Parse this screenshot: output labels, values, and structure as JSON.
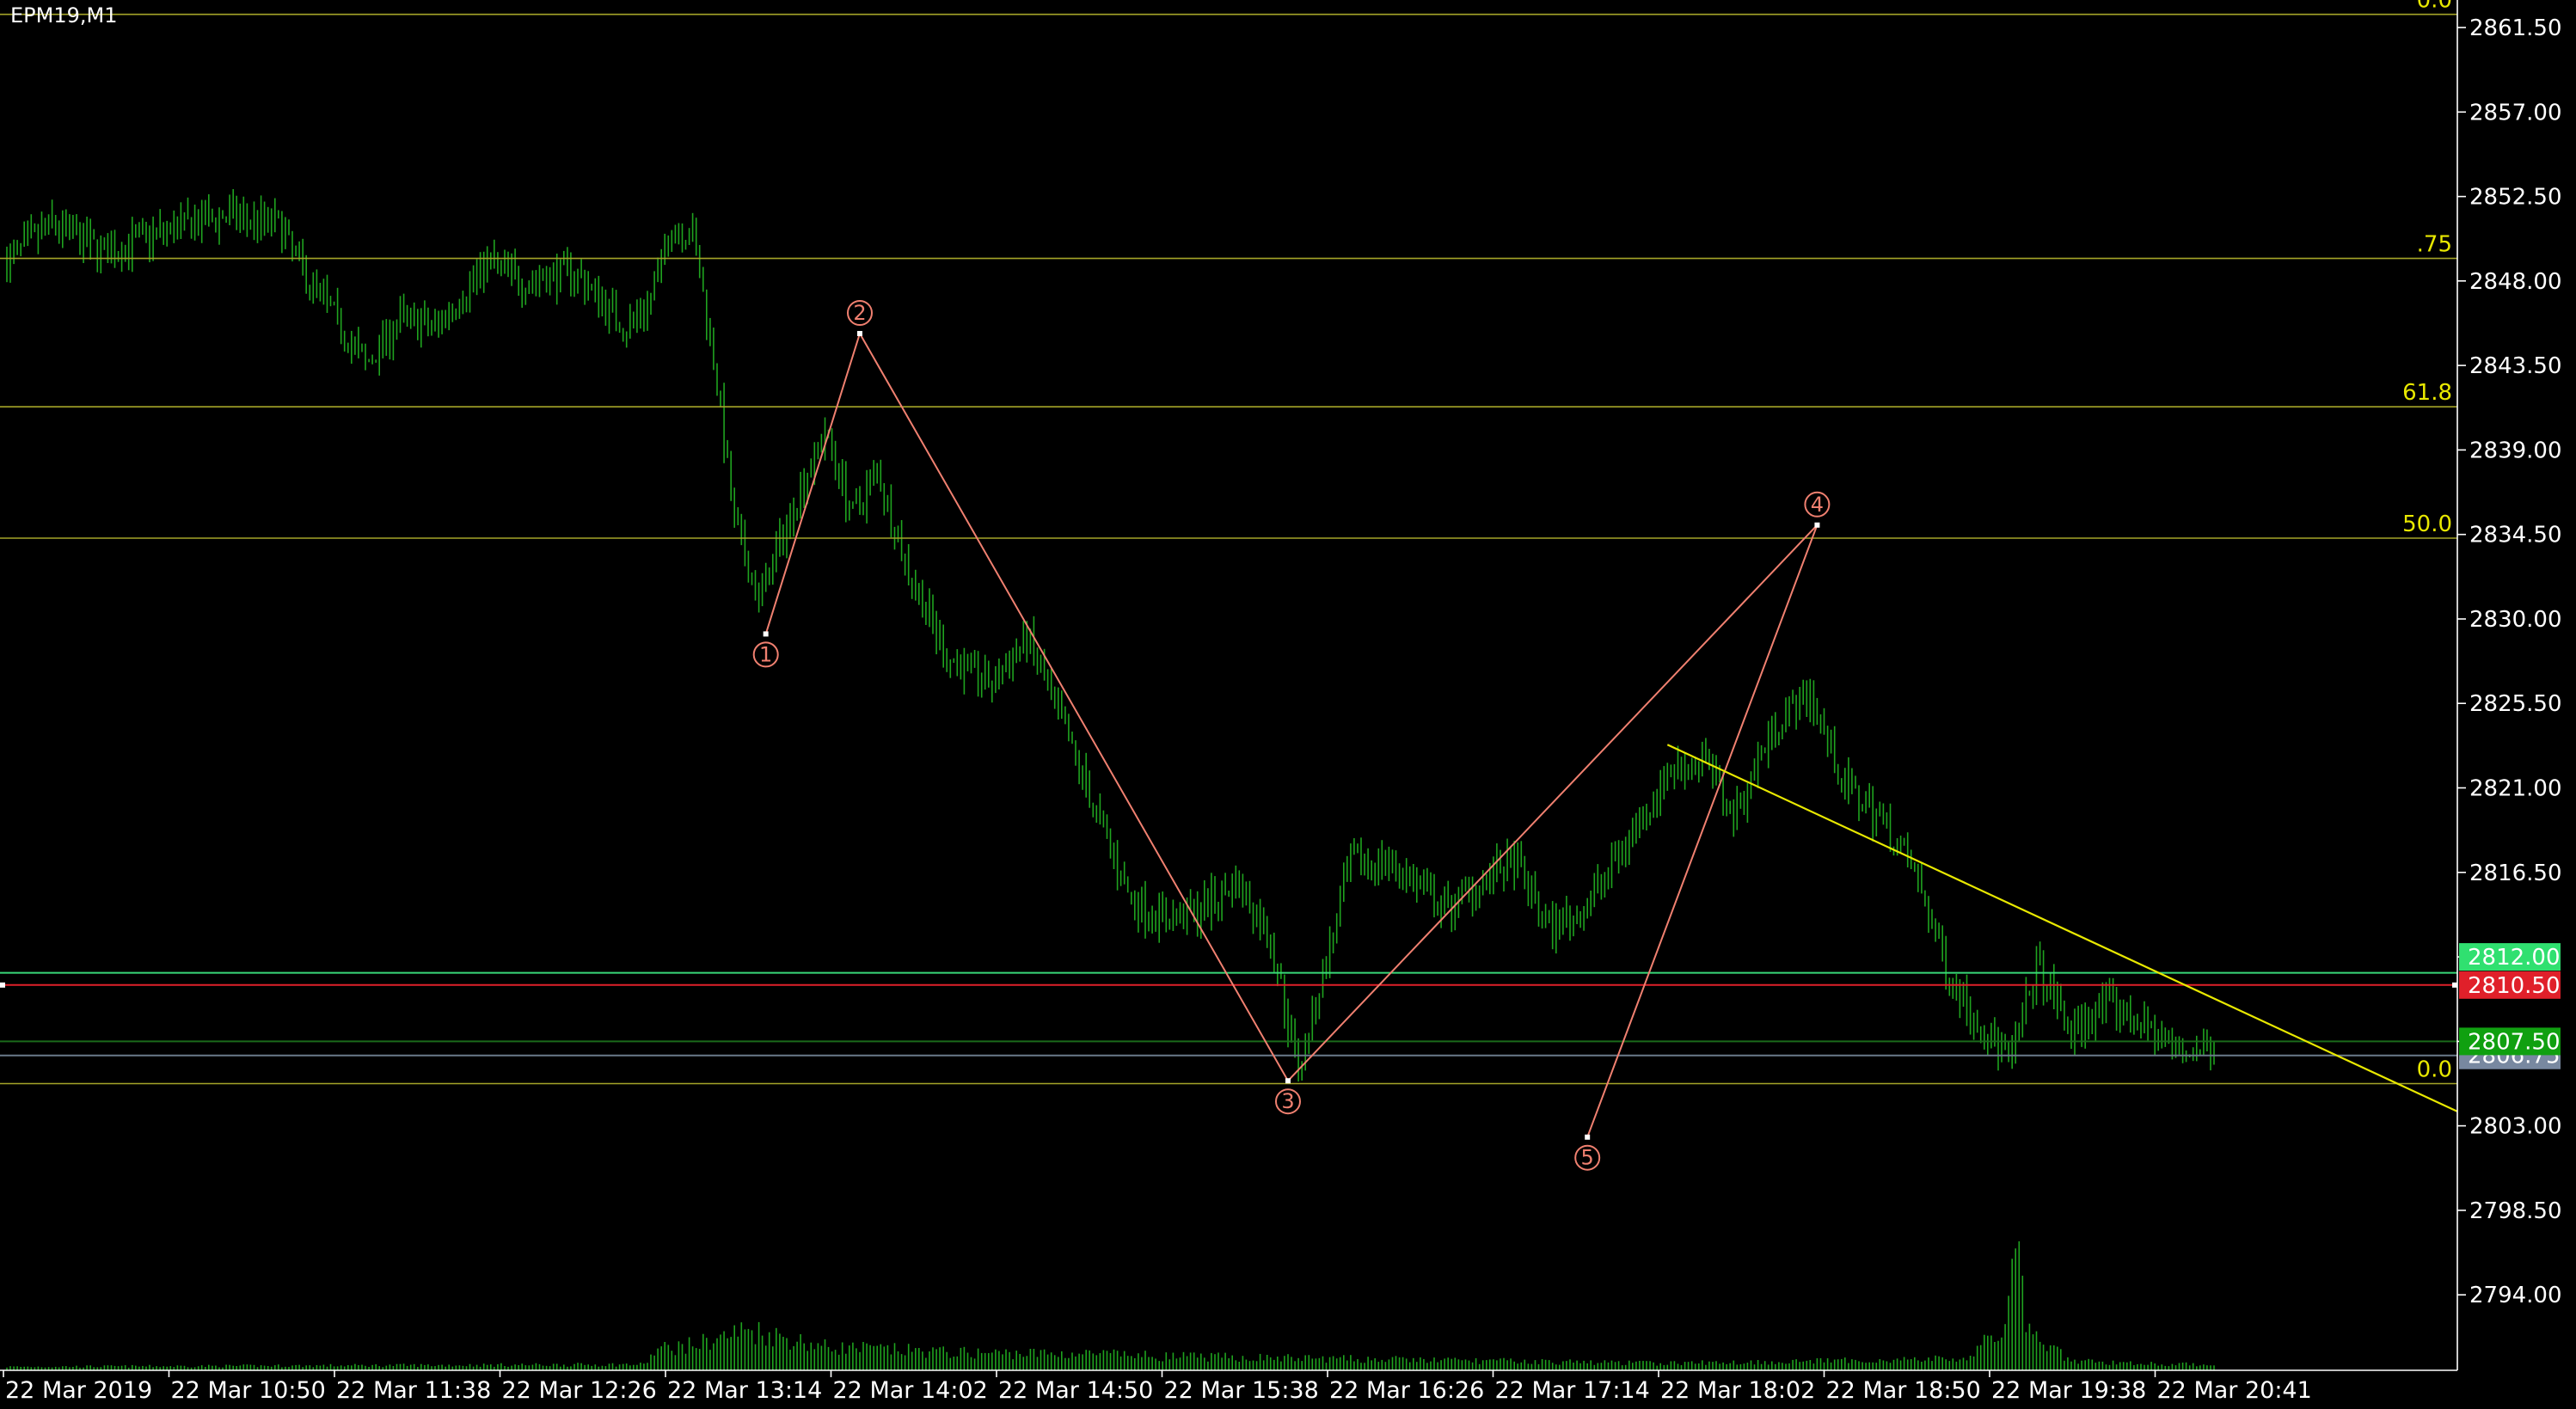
{
  "symbol": "EPM19,M1",
  "colors": {
    "background": "#000000",
    "grid_axis": "#ffffff",
    "candles": "#1fa31f",
    "volume": "#1fa31f",
    "fib_lines": "#a5a528",
    "fib_labels": "#e8e800",
    "wave_lines": "#f08070",
    "trendline": "#e8e800",
    "line_green": "#38d878",
    "line_red": "#e0202a",
    "line_darkgreen": "#1a6a1a",
    "line_gray": "#6a7a8a",
    "tag_bid": "#7888a0",
    "tag_green": "#10a010",
    "tag_red": "#e0202a",
    "tag_lightgreen": "#30e070"
  },
  "price_tags": [
    {
      "label": "2810.50",
      "price": 2810.5,
      "color": "#e0202a",
      "text_color": "#ffffff"
    },
    {
      "label": "2806.75",
      "price": 2806.75,
      "color": "#7888a0",
      "text_color": "#ffffff"
    },
    {
      "label": "2807.50",
      "price": 2807.5,
      "color": "#10a010",
      "text_color": "#ffffff"
    },
    {
      "label": "2812.00",
      "price": 2812.0,
      "color": "#30e070",
      "text_color": "#ffffff"
    }
  ],
  "chart_data": {
    "type": "candlestick",
    "title": "EPM19,M1",
    "yticks": [
      "2861.50",
      "2857.00",
      "2852.50",
      "2848.00",
      "2843.50",
      "2839.00",
      "2834.50",
      "2830.00",
      "2825.50",
      "2821.00",
      "2816.50",
      "2812.00",
      "2807.50",
      "2803.00",
      "2798.50",
      "2794.00"
    ],
    "ylim": [
      2790.25,
      2862.5
    ],
    "xticks": [
      "22 Mar 2019",
      "22 Mar 10:50",
      "22 Mar 11:38",
      "22 Mar 12:26",
      "22 Mar 13:14",
      "22 Mar 14:02",
      "22 Mar 14:50",
      "22 Mar 15:38",
      "22 Mar 16:26",
      "22 Mar 17:14",
      "22 Mar 18:02",
      "22 Mar 18:50",
      "22 Mar 19:38",
      "22 Mar 20:41"
    ],
    "fibonacci": [
      {
        "label": "0.0",
        "price": 2805.25
      },
      {
        "label": "50.0",
        "price": 2834.3
      },
      {
        "label": "61.8",
        "price": 2841.3
      },
      {
        "label": ".75",
        "price": 2849.2
      },
      {
        "label": "0.0",
        "price": 2862.2
      }
    ],
    "horizontal_lines": [
      {
        "price": 2811.15,
        "color": "#38d878"
      },
      {
        "price": 2810.5,
        "color": "#e0202a"
      },
      {
        "price": 2807.5,
        "color": "#1a6a1a"
      },
      {
        "price": 2806.75,
        "color": "#6a7a8a"
      }
    ],
    "wave_points": [
      {
        "label": "1",
        "time": "13:45",
        "price": 2829.2
      },
      {
        "label": "2",
        "time": "14:12",
        "price": 2845.2
      },
      {
        "label": "3",
        "time": "16:15",
        "price": 2805.4
      },
      {
        "label": "4",
        "time": "18:47",
        "price": 2835.0
      },
      {
        "label": "5",
        "time": "17:41",
        "price": 2802.4
      }
    ],
    "trendline": {
      "start": {
        "time": "18:04",
        "price": 2823.3
      },
      "end": {
        "time": "20:41",
        "price": 2805.6
      }
    },
    "price_path": [
      [
        "10:07",
        2849.0
      ],
      [
        "10:20",
        2851.0
      ],
      [
        "10:35",
        2849.5
      ],
      [
        "10:50",
        2850.5
      ],
      [
        "11:10",
        2851.5
      ],
      [
        "11:25",
        2851.0
      ],
      [
        "11:32",
        2848.5
      ],
      [
        "11:38",
        2847.0
      ],
      [
        "11:50",
        2843.5
      ],
      [
        "12:00",
        2846.0
      ],
      [
        "12:10",
        2845.5
      ],
      [
        "12:25",
        2849.0
      ],
      [
        "12:35",
        2848.0
      ],
      [
        "12:50",
        2848.5
      ],
      [
        "13:05",
        2845.5
      ],
      [
        "13:12",
        2847.0
      ],
      [
        "13:18",
        2851.0
      ],
      [
        "13:24",
        2850.5
      ],
      [
        "13:30",
        2844.0
      ],
      [
        "13:36",
        2835.0
      ],
      [
        "13:43",
        2831.0
      ],
      [
        "13:55",
        2837.0
      ],
      [
        "14:02",
        2840.0
      ],
      [
        "14:10",
        2835.5
      ],
      [
        "14:17",
        2838.0
      ],
      [
        "14:25",
        2833.0
      ],
      [
        "14:37",
        2828.0
      ],
      [
        "14:50",
        2826.5
      ],
      [
        "15:00",
        2829.0
      ],
      [
        "15:15",
        2822.0
      ],
      [
        "15:30",
        2815.0
      ],
      [
        "15:40",
        2814.0
      ],
      [
        "15:50",
        2814.5
      ],
      [
        "16:00",
        2816.0
      ],
      [
        "16:10",
        2813.0
      ],
      [
        "16:18",
        2806.0
      ],
      [
        "16:25",
        2811.0
      ],
      [
        "16:33",
        2817.0
      ],
      [
        "16:45",
        2817.0
      ],
      [
        "17:00",
        2814.5
      ],
      [
        "17:10",
        2816.0
      ],
      [
        "17:20",
        2817.0
      ],
      [
        "17:30",
        2813.5
      ],
      [
        "17:40",
        2814.5
      ],
      [
        "17:55",
        2819.0
      ],
      [
        "18:05",
        2822.0
      ],
      [
        "18:15",
        2822.5
      ],
      [
        "18:23",
        2819.5
      ],
      [
        "18:35",
        2824.5
      ],
      [
        "18:45",
        2826.0
      ],
      [
        "18:55",
        2821.0
      ],
      [
        "19:05",
        2819.5
      ],
      [
        "19:15",
        2816.5
      ],
      [
        "19:25",
        2811.0
      ],
      [
        "19:35",
        2808.0
      ],
      [
        "19:43",
        2806.5
      ],
      [
        "19:50",
        2811.5
      ],
      [
        "20:00",
        2808.0
      ],
      [
        "20:10",
        2809.5
      ],
      [
        "20:20",
        2808.5
      ],
      [
        "20:30",
        2807.0
      ]
    ],
    "volume_path": [
      [
        "10:07",
        0.03
      ],
      [
        "13:10",
        0.05
      ],
      [
        "13:14",
        0.18
      ],
      [
        "13:25",
        0.22
      ],
      [
        "13:40",
        0.35
      ],
      [
        "14:02",
        0.2
      ],
      [
        "14:40",
        0.15
      ],
      [
        "15:20",
        0.14
      ],
      [
        "15:38",
        0.12
      ],
      [
        "16:26",
        0.1
      ],
      [
        "17:14",
        0.08
      ],
      [
        "18:02",
        0.06
      ],
      [
        "18:50",
        0.08
      ],
      [
        "19:30",
        0.1
      ],
      [
        "19:40",
        0.35
      ],
      [
        "19:44",
        1.0
      ],
      [
        "19:48",
        0.3
      ],
      [
        "20:00",
        0.08
      ],
      [
        "20:30",
        0.05
      ]
    ]
  }
}
